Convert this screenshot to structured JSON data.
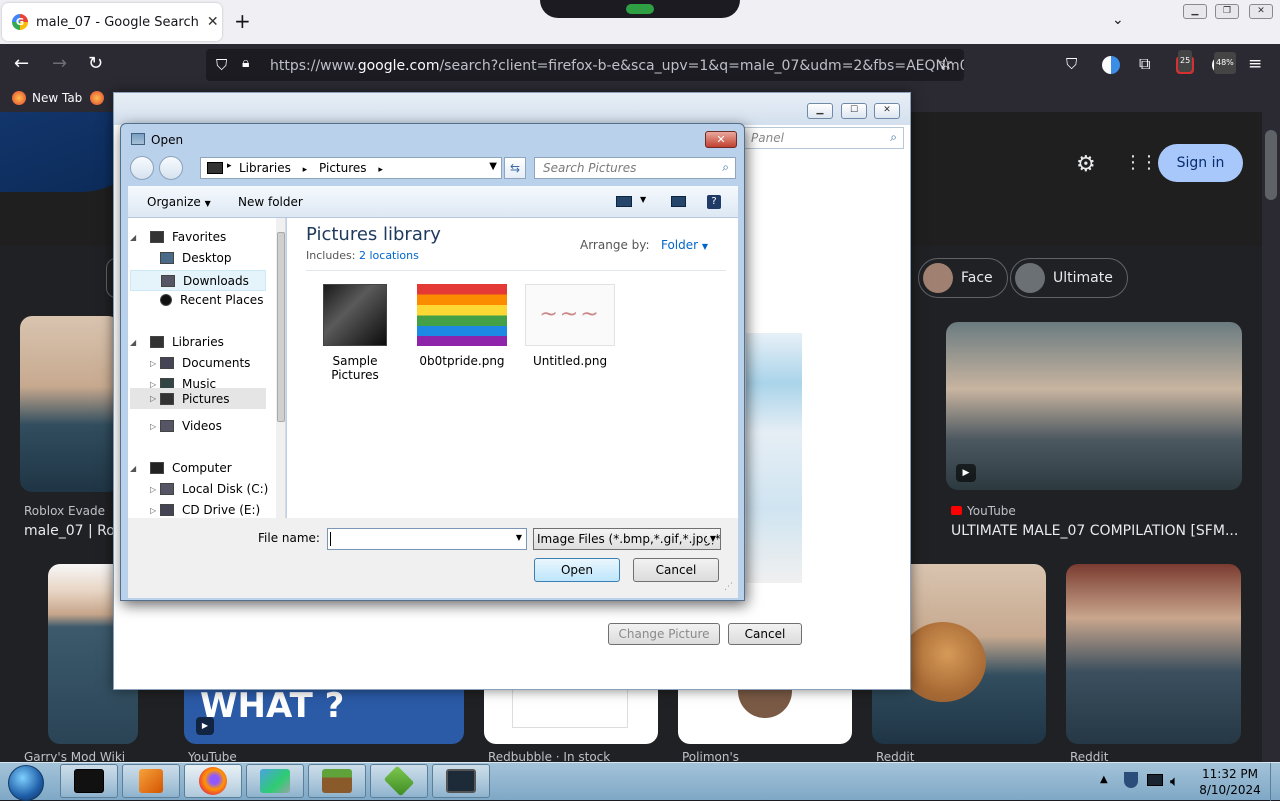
{
  "browser": {
    "tab_title": "male_07 - Google Search",
    "tab_favicon": "G",
    "url_prefix": "https://www.",
    "url_domain": "google.com",
    "url_rest": "/search?client=firefox-b-e&sca_upv=1&q=male_07&udm=2&fbs=AEQNm0Aa4sjW",
    "badge_1": "25",
    "badge_2": "48%",
    "bookmark_1": "New Tab"
  },
  "google": {
    "sign_in": "Sign in",
    "chips": [
      "Face",
      "Ultimate"
    ],
    "results": [
      {
        "source": "Roblox Evade",
        "title": "male_07 | Rob"
      },
      {
        "source": "YouTube",
        "title": "ULTIMATE MALE_07 COMPILATION [SFM..."
      }
    ],
    "bottom_sources": [
      "Garry's Mod Wiki",
      "YouTube",
      "Redbubble · In stock",
      "Polimon's",
      "Reddit",
      "Reddit"
    ],
    "thumb_text": "WHAT ?"
  },
  "background_dialog": {
    "panel_search": "Panel",
    "change_picture": "Change Picture",
    "cancel": "Cancel"
  },
  "open_dialog": {
    "title": "Open",
    "breadcrumb": [
      "Libraries",
      "Pictures"
    ],
    "search_placeholder": "Search Pictures",
    "organize": "Organize",
    "new_folder": "New folder",
    "library_title": "Pictures library",
    "includes_label": "Includes:",
    "includes_link": "2 locations",
    "arrange_label": "Arrange by:",
    "arrange_value": "Folder",
    "nav": {
      "favorites": "Favorites",
      "desktop": "Desktop",
      "downloads": "Downloads",
      "recent": "Recent Places",
      "libraries": "Libraries",
      "documents": "Documents",
      "music": "Music",
      "pictures": "Pictures",
      "videos": "Videos",
      "computer": "Computer",
      "local_disk": "Local Disk (C:)",
      "cd_drive": "CD Drive (E:)"
    },
    "files": [
      {
        "name": "Sample Pictures"
      },
      {
        "name": "0b0tpride.png"
      },
      {
        "name": "Untitled.png"
      }
    ],
    "file_name_label": "File name:",
    "file_name_value": "",
    "file_type": "Image Files (*.bmp,*.gif,*.jpg,*.",
    "open_button": "Open",
    "cancel_button": "Cancel"
  },
  "taskbar": {
    "time": "11:32 PM",
    "date": "8/10/2024"
  },
  "colors": {
    "browser_dark": "#2b2a33",
    "google_bg": "#202124",
    "sign_in_bg": "#a8c7fa",
    "dialog_frame": "#b9d1ea",
    "library_title": "#1e395b",
    "link_blue": "#0066cc"
  }
}
